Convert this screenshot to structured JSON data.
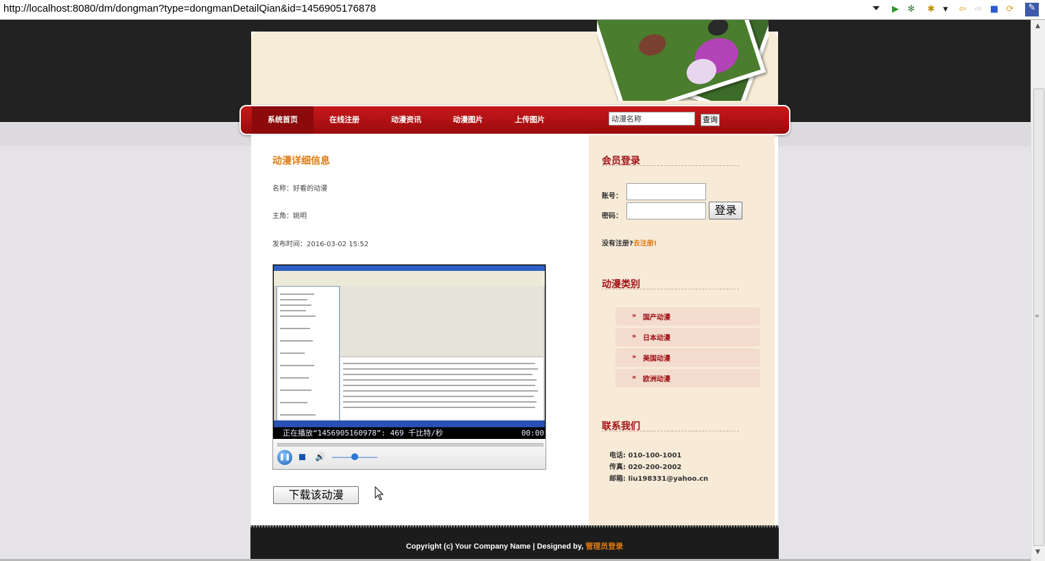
{
  "browser": {
    "url": "http://localhost:8080/dm/dongman?type=dongmanDetailQian&id=1456905176878"
  },
  "nav": {
    "items": [
      "系统首页",
      "在线注册",
      "动漫资讯",
      "动漫图片",
      "上传图片"
    ],
    "search_value": "动漫名称",
    "search_button": "查询"
  },
  "detail": {
    "heading": "动漫详细信息",
    "name_label": "名称：",
    "name_value": "好看的动漫",
    "lead_label": "主角：",
    "lead_value": "姚明",
    "time_label": "发布时间：",
    "time_value": "2016-03-02 15:52",
    "player": {
      "status": "正在播放“1456905160978”: 469 千比特/秒",
      "time": "00:00"
    },
    "download_button": "下载该动漫"
  },
  "sidebar": {
    "login": {
      "heading": "会员登录",
      "account_label": "账号：",
      "password_label": "密码：",
      "login_button": "登录",
      "register_prompt": "没有注册?",
      "register_link": "去注册!"
    },
    "categories": {
      "heading": "动漫类别",
      "items": [
        "国产动漫",
        "日本动漫",
        "美国动漫",
        "欧洲动漫"
      ]
    },
    "contact": {
      "heading": "联系我们",
      "phone": "电话: 010-100-1001",
      "fax": "传真: 020-200-2002",
      "email": "邮箱: liu198331@yahoo.cn"
    }
  },
  "footer": {
    "copyright": "Copyright (c) Your Company Name | Designed by,",
    "admin_link": "管理员登录"
  },
  "colors": {
    "nav_red": "#b01215",
    "heading_orange": "#e07a10",
    "sidebar_red": "#a11015",
    "sidebar_bg": "#f7ebd8"
  }
}
